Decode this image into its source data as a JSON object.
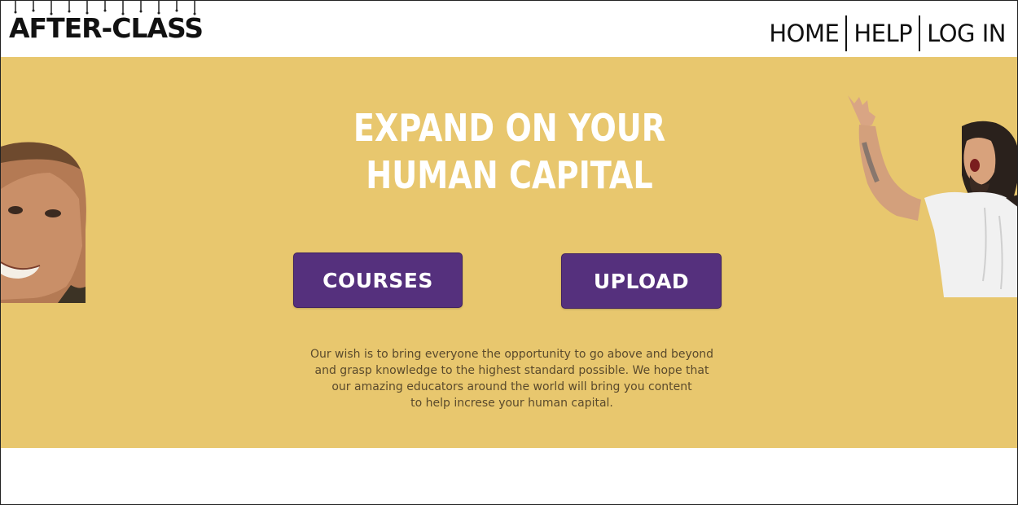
{
  "header": {
    "logo_text": "AFTER-CLASS",
    "nav": {
      "home": "HOME",
      "help": "HELP",
      "login": "LOG IN"
    }
  },
  "hero": {
    "headline_line1": "EXPAND ON YOUR",
    "headline_line2": "HUMAN CAPITAL",
    "buttons": {
      "courses": "COURSES",
      "upload": "UPLOAD"
    },
    "description_lines": [
      "Our wish is to bring everyone the opportunity to go above and beyond",
      "and grasp knowledge to the highest standard possible. We hope that",
      "our amazing educators around the world will bring you content",
      "to help increse your human capital."
    ]
  },
  "colors": {
    "hero_background": "#e8c76e",
    "button_background": "#55307d",
    "headline": "#ffffff",
    "body_text": "#5a4a2c"
  }
}
